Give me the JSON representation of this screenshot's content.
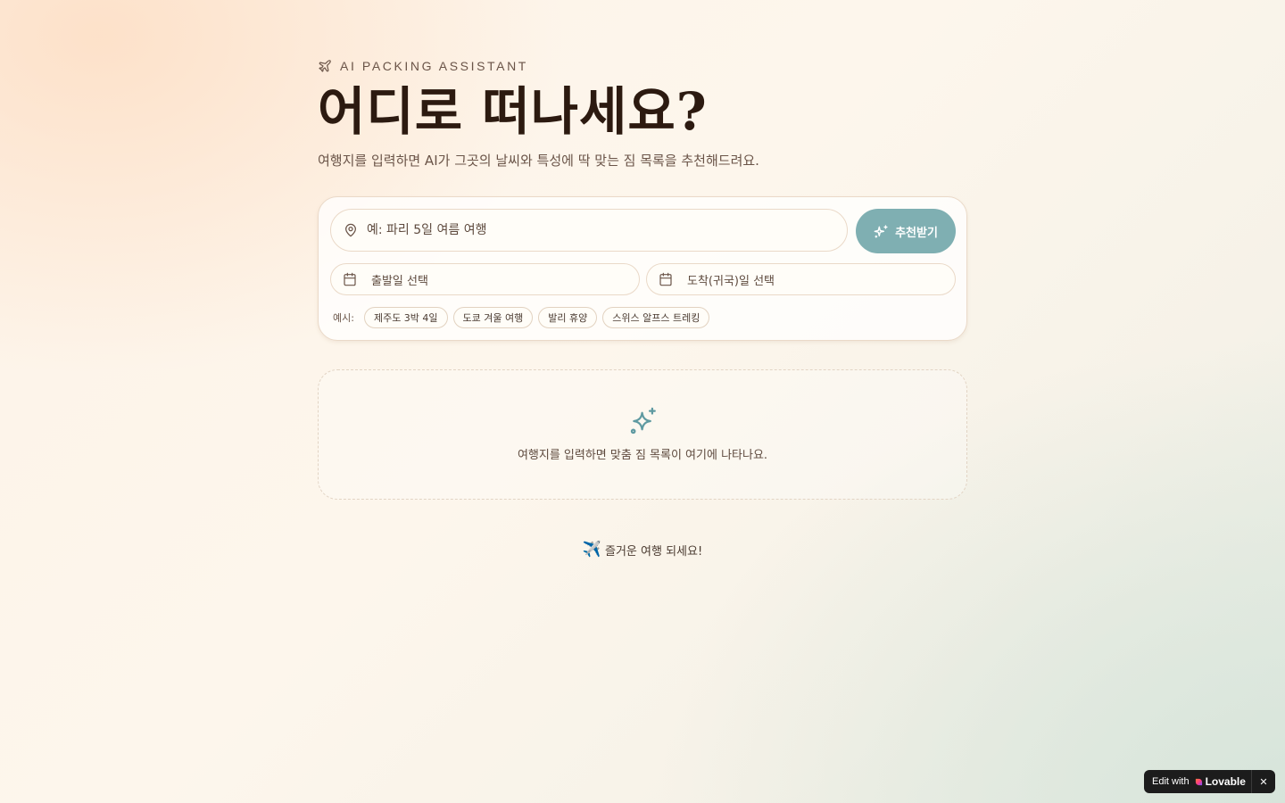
{
  "header": {
    "eyebrow": "AI PACKING ASSISTANT",
    "eyebrow_icon": "plane-icon",
    "title": "어디로 떠나세요?",
    "subtitle": "여행지를 입력하면 AI가 그곳의 날씨와 특성에 딱 맞는 짐 목록을 추천해드려요."
  },
  "search": {
    "destination_placeholder": "예: 파리 5일 여름 여행",
    "destination_value": "",
    "destination_icon": "map-pin-icon",
    "recommend_label": "추천받기",
    "recommend_icon": "sparkles-icon",
    "departure_label": "출발일 선택",
    "return_label": "도착(귀국)일 선택",
    "date_icon": "calendar-icon",
    "examples_label": "예시:",
    "examples": [
      "제주도 3박 4일",
      "도쿄 겨울 여행",
      "발리 휴양",
      "스위스 알프스 트레킹"
    ]
  },
  "empty_state": {
    "icon": "sparkles-icon",
    "message": "여행지를 입력하면 맞춤 짐 목록이 여기에 나타나요."
  },
  "footer": {
    "emoji": "✈️",
    "message": "즐거운 여행 되세요!"
  },
  "badge": {
    "edit_label": "Edit with",
    "brand": "Lovable",
    "close": "✕"
  },
  "colors": {
    "accent": "#7fafb2",
    "title_text": "#2c1a10",
    "body_text": "#6a5448",
    "card_border": "#ead9c8"
  }
}
